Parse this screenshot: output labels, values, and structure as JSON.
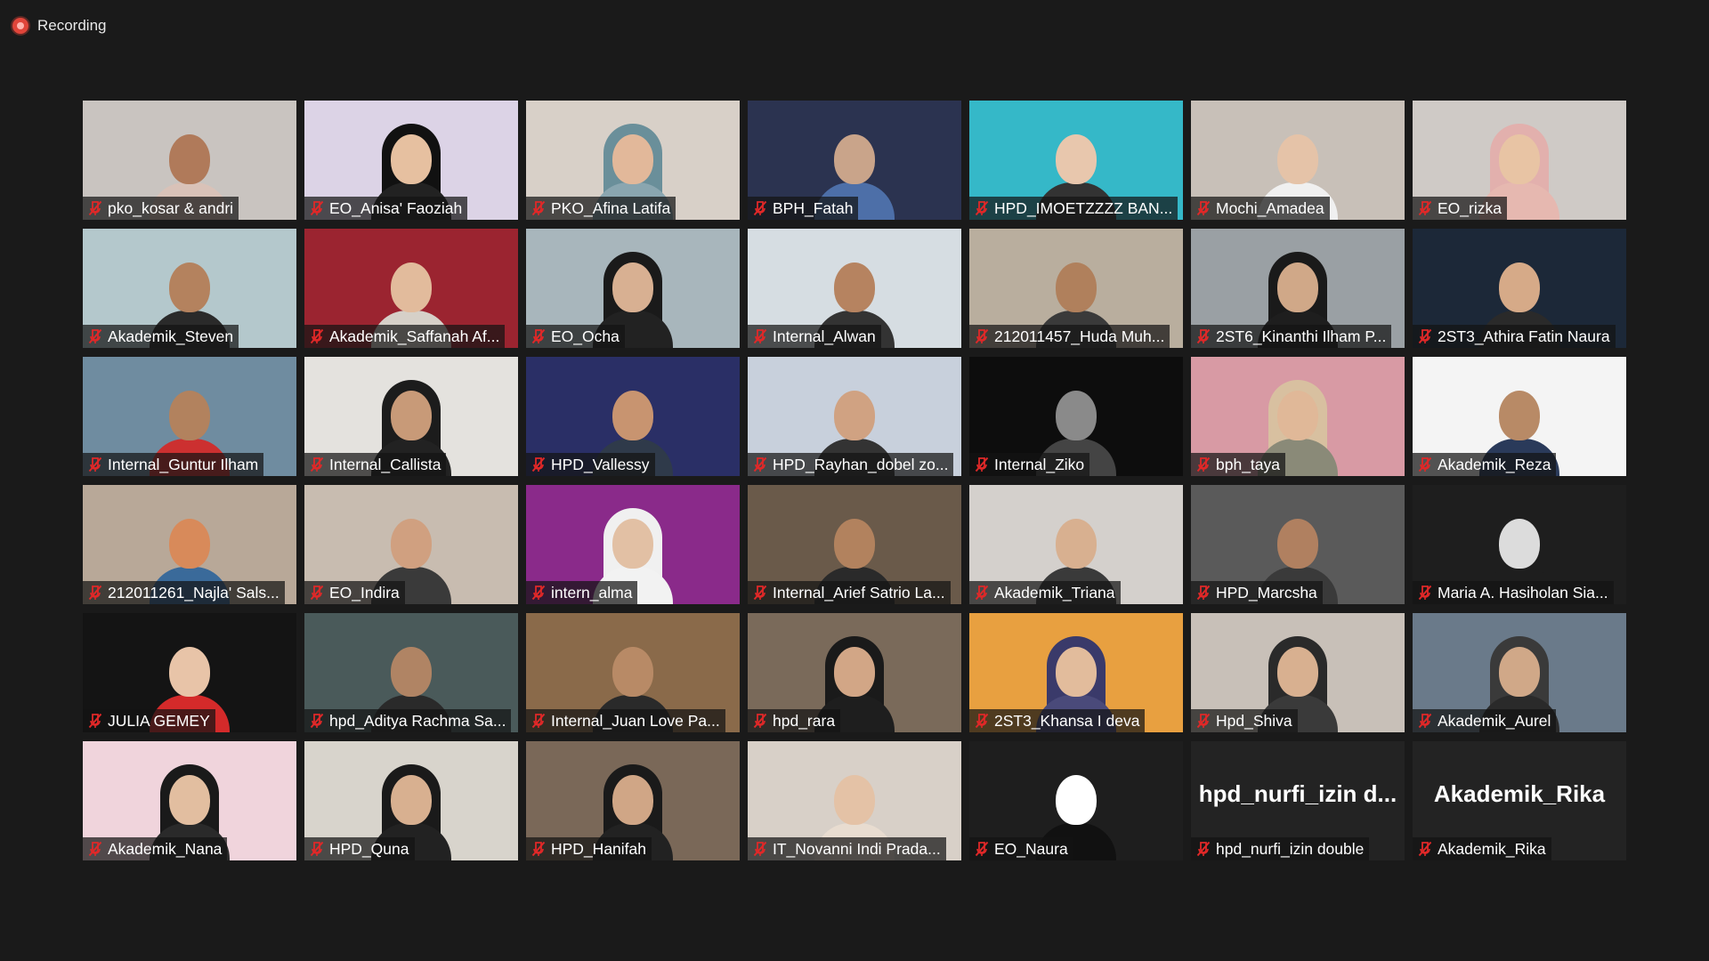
{
  "recording": {
    "label": "Recording"
  },
  "participants": [
    {
      "name": "pko_kosar & andri",
      "bg": "#c9c4c0",
      "skin": "#b07a5a",
      "cloth": "#d9c2b8",
      "hijab": ""
    },
    {
      "name": "EO_Anisa' Faoziah",
      "bg": "#dcd3e6",
      "skin": "#e6c0a0",
      "cloth": "#222222",
      "hijab": "#111111"
    },
    {
      "name": "PKO_Afina Latifa",
      "bg": "#d8d0c8",
      "skin": "#e2b89a",
      "cloth": "#8aa6b0",
      "hijab": "#6a8f9a"
    },
    {
      "name": "BPH_Fatah",
      "bg": "#2b3350",
      "skin": "#c9a48a",
      "cloth": "#4d6fa8",
      "hijab": ""
    },
    {
      "name": "HPD_IMOETZZZZ BAN...",
      "bg": "#35b8c8",
      "skin": "#e8c7ad",
      "cloth": "#333333",
      "hijab": ""
    },
    {
      "name": "Mochi_Amadea",
      "bg": "#c8c0b8",
      "skin": "#e5c3a8",
      "cloth": "#f0f0f0",
      "hijab": ""
    },
    {
      "name": "EO_rizka",
      "bg": "#cfcac6",
      "skin": "#e8c4a4",
      "cloth": "#e6b8b0",
      "hijab": "#e2b0ad"
    },
    {
      "name": "Akademik_Steven",
      "bg": "#b4c8cc",
      "skin": "#b4825e",
      "cloth": "#2a2a2a",
      "hijab": ""
    },
    {
      "name": "Akademik_Saffanah Af...",
      "bg": "#9b2430",
      "skin": "#e2bb9c",
      "cloth": "#d6d0c8",
      "hijab": ""
    },
    {
      "name": "EO_Ocha",
      "bg": "#a8b6bc",
      "skin": "#d8b092",
      "cloth": "#222222",
      "hijab": "#1a1a1a"
    },
    {
      "name": "Internal_Alwan",
      "bg": "#d6dde2",
      "skin": "#b68360",
      "cloth": "#333333",
      "hijab": ""
    },
    {
      "name": "212011457_Huda Muh...",
      "bg": "#b9ae9e",
      "skin": "#b0805c",
      "cloth": "#3a3a3a",
      "hijab": ""
    },
    {
      "name": "2ST6_Kinanthi Ilham P...",
      "bg": "#9aa0a4",
      "skin": "#d0a888",
      "cloth": "#1e1e1e",
      "hijab": "#1a1a1a"
    },
    {
      "name": "2ST3_Athira Fatin Naura",
      "bg": "#1c2838",
      "skin": "#d6aa88",
      "cloth": "#2a2a2a",
      "hijab": ""
    },
    {
      "name": "Internal_Guntur Ilham",
      "bg": "#6f8ca0",
      "skin": "#b2825e",
      "cloth": "#cc3030",
      "hijab": ""
    },
    {
      "name": "Internal_Callista",
      "bg": "#e4e2de",
      "skin": "#c89a78",
      "cloth": "#222222",
      "hijab": "#1c1c1c"
    },
    {
      "name": "HPD_Vallessy",
      "bg": "#2a2f66",
      "skin": "#c89470",
      "cloth": "#2f3a4a",
      "hijab": ""
    },
    {
      "name": "HPD_Rayhan_dobel zo...",
      "bg": "#c8d0dc",
      "skin": "#d0a282",
      "cloth": "#333333",
      "hijab": ""
    },
    {
      "name": "Internal_Ziko",
      "bg": "#0d0d0d",
      "skin": "#8a8a8a",
      "cloth": "#444444",
      "hijab": ""
    },
    {
      "name": "bph_taya",
      "bg": "#d89aa4",
      "skin": "#e0b898",
      "cloth": "#8a8a78",
      "hijab": "#d8c0a0"
    },
    {
      "name": "Akademik_Reza",
      "bg": "#f4f4f4",
      "skin": "#b88a66",
      "cloth": "#2a3a5a",
      "hijab": ""
    },
    {
      "name": "212011261_Najla' Sals...",
      "bg": "#b8a898",
      "skin": "#d88a5a",
      "cloth": "#3a6a9a",
      "hijab": ""
    },
    {
      "name": "EO_Indira",
      "bg": "#c8bcb0",
      "skin": "#d0a080",
      "cloth": "#3a3a3a",
      "hijab": ""
    },
    {
      "name": "intern_alma",
      "bg": "#8a2a8a",
      "skin": "#e2c0a4",
      "cloth": "#f2f2f2",
      "hijab": "#f0f0f0"
    },
    {
      "name": "Internal_Arief Satrio La...",
      "bg": "#6a5a4a",
      "skin": "#b2825e",
      "cloth": "#2a2a2a",
      "hijab": ""
    },
    {
      "name": "Akademik_Triana",
      "bg": "#d4d0cc",
      "skin": "#d8b090",
      "cloth": "#3a3a3a",
      "hijab": ""
    },
    {
      "name": "HPD_Marcsha",
      "bg": "#5a5a5a",
      "skin": "#b08060",
      "cloth": "#3a3a3a",
      "hijab": ""
    },
    {
      "name": "Maria A. Hasiholan Sia...",
      "bg": "#1e1e1e",
      "skin": "#dcdcdc",
      "cloth": "#1e1e1e",
      "hijab": ""
    },
    {
      "name": "JULIA GEMEY",
      "bg": "#141414",
      "skin": "#e8c4a8",
      "cloth": "#d42a2a",
      "hijab": ""
    },
    {
      "name": "hpd_Aditya Rachma Sa...",
      "bg": "#4a5a5a",
      "skin": "#b08464",
      "cloth": "#2a2a2a",
      "hijab": ""
    },
    {
      "name": "Internal_Juan Love Pa...",
      "bg": "#8a6a4a",
      "skin": "#b88a66",
      "cloth": "#2a2a2a",
      "hijab": ""
    },
    {
      "name": "hpd_rara",
      "bg": "#7a6a5a",
      "skin": "#d2a686",
      "cloth": "#1e1e1e",
      "hijab": "#1a1a1a"
    },
    {
      "name": "2ST3_Khansa I deva",
      "bg": "#e8a040",
      "skin": "#e2bc9c",
      "cloth": "#4a4a7a",
      "hijab": "#3a3a6a"
    },
    {
      "name": "Hpd_Shiva",
      "bg": "#c8c0b8",
      "skin": "#d8b090",
      "cloth": "#3a3a3a",
      "hijab": "#2a2a2a"
    },
    {
      "name": "Akademik_Aurel",
      "bg": "#6a7a8a",
      "skin": "#d0a888",
      "cloth": "#2a2a2a",
      "hijab": "#3a3a3a"
    },
    {
      "name": "Akademik_Nana",
      "bg": "#f0d4dc",
      "skin": "#e2bea0",
      "cloth": "#2a2a2a",
      "hijab": "#1a1a1a"
    },
    {
      "name": "HPD_Quna",
      "bg": "#d8d4cc",
      "skin": "#d8b090",
      "cloth": "#222222",
      "hijab": "#1a1a1a"
    },
    {
      "name": "HPD_Hanifah",
      "bg": "#7a6858",
      "skin": "#d0a686",
      "cloth": "#222222",
      "hijab": "#1a1a1a"
    },
    {
      "name": "IT_Novanni Indi Prada...",
      "bg": "#d8d0c8",
      "skin": "#e4c2a6",
      "cloth": "#e8dcd0",
      "hijab": ""
    },
    {
      "name": "EO_Naura",
      "bg": "#1e1e1e",
      "skin": "#ffffff",
      "cloth": "#111111",
      "hijab": ""
    },
    {
      "name": "hpd_nurfi_izin double",
      "big": "hpd_nurfi_izin d...",
      "bg": "#232323"
    },
    {
      "name": "Akademik_Rika",
      "big": "Akademik_Rika",
      "bg": "#232323"
    }
  ],
  "colors": {
    "background": "#1a1a1a",
    "mute": "#e02828",
    "recording": "#e0453a"
  }
}
